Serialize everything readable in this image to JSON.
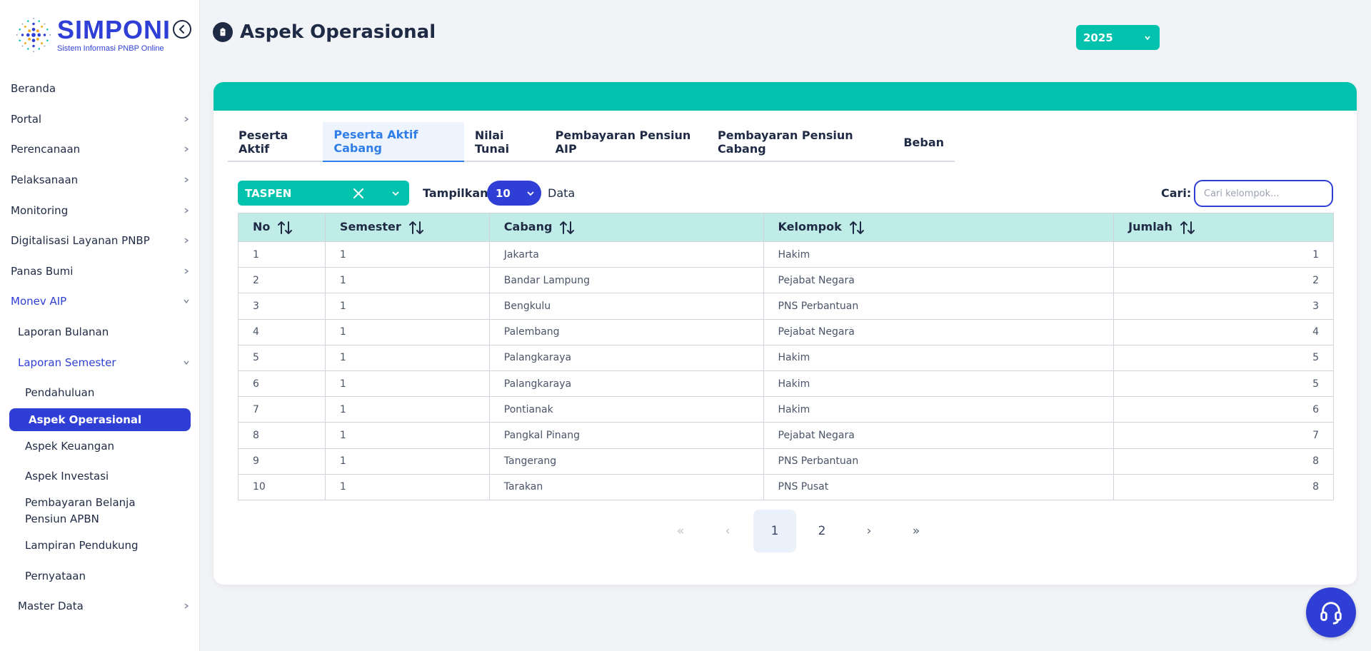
{
  "app": {
    "logo_title": "SIMPONI",
    "logo_subtitle": "Sistem Informasi PNBP Online"
  },
  "sidebar": {
    "items": [
      {
        "label": "Beranda"
      },
      {
        "label": "Portal"
      },
      {
        "label": "Perencanaan"
      },
      {
        "label": "Pelaksanaan"
      },
      {
        "label": "Monitoring"
      },
      {
        "label": "Digitalisasi Layanan PNBP"
      },
      {
        "label": "Panas Bumi"
      },
      {
        "label": "Monev AIP"
      },
      {
        "label": "Laporan Bulanan"
      },
      {
        "label": "Laporan Semester"
      },
      {
        "label": "Pendahuluan"
      },
      {
        "label": "Aspek Operasional"
      },
      {
        "label": "Aspek Keuangan"
      },
      {
        "label": "Aspek Investasi"
      },
      {
        "label": "Pembayaran Belanja Pensiun APBN"
      },
      {
        "label": "Lampiran Pendukung"
      },
      {
        "label": "Pernyataan"
      },
      {
        "label": "Master Data"
      }
    ]
  },
  "header": {
    "title": "Aspek Operasional",
    "year": "2025"
  },
  "tabs": [
    {
      "label": "Peserta Aktif"
    },
    {
      "label": "Peserta Aktif Cabang"
    },
    {
      "label": "Nilai Tunai"
    },
    {
      "label": "Pembayaran Pensiun AIP"
    },
    {
      "label": "Pembayaran Pensiun Cabang"
    },
    {
      "label": "Beban"
    }
  ],
  "controls": {
    "filter_value": "TASPEN",
    "show_label": "Tampilkan",
    "per_page": "10",
    "data_label": "Data",
    "search_label": "Cari:",
    "search_placeholder": "Cari kelompok..."
  },
  "table": {
    "columns": [
      "No",
      "Semester",
      "Cabang",
      "Kelompok",
      "Jumlah"
    ],
    "rows": [
      [
        "1",
        "1",
        "Jakarta",
        "Hakim",
        "1"
      ],
      [
        "2",
        "1",
        "Bandar Lampung",
        "Pejabat Negara",
        "2"
      ],
      [
        "3",
        "1",
        "Bengkulu",
        "PNS Perbantuan",
        "3"
      ],
      [
        "4",
        "1",
        "Palembang",
        "Pejabat Negara",
        "4"
      ],
      [
        "5",
        "1",
        "Palangkaraya",
        "Hakim",
        "5"
      ],
      [
        "6",
        "1",
        "Palangkaraya",
        "Hakim",
        "5"
      ],
      [
        "7",
        "1",
        "Pontianak",
        "Hakim",
        "6"
      ],
      [
        "8",
        "1",
        "Pangkal Pinang",
        "Pejabat Negara",
        "7"
      ],
      [
        "9",
        "1",
        "Tangerang",
        "PNS Perbantuan",
        "8"
      ],
      [
        "10",
        "1",
        "Tarakan",
        "PNS Pusat",
        "8"
      ]
    ]
  },
  "pagination": {
    "first": "«",
    "prev": "‹",
    "pages": [
      "1",
      "2"
    ],
    "current": "1",
    "next": "›",
    "last": "»"
  },
  "colors": {
    "primary": "#2f3fd6",
    "teal": "#00c2ad",
    "table_header": "#c0ece7",
    "active_tab": "#2f7ee8"
  }
}
